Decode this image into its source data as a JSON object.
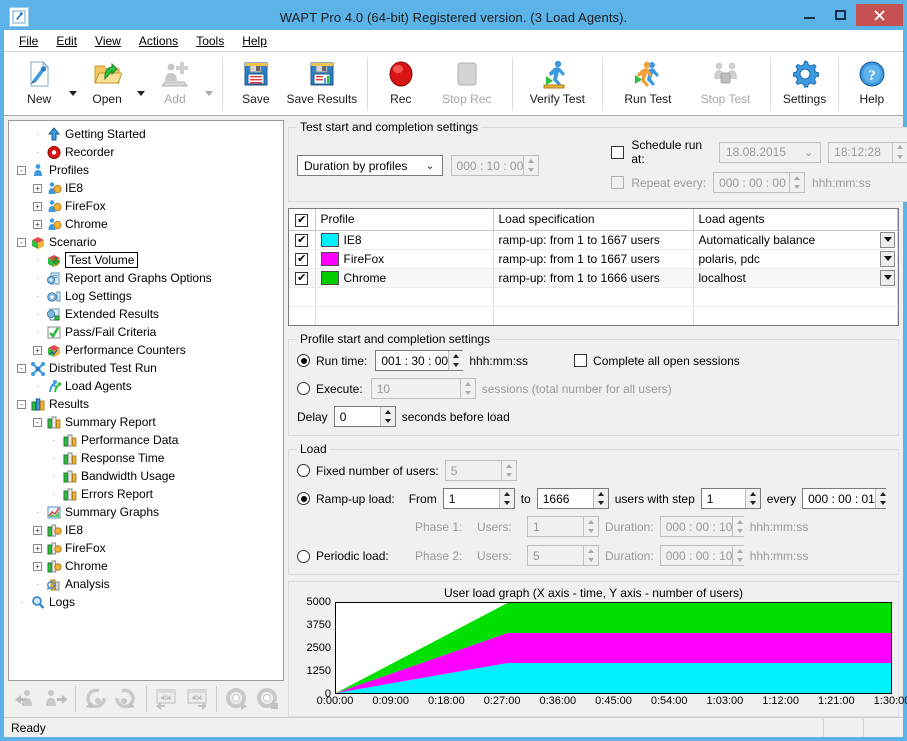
{
  "window": {
    "title": "WAPT Pro 4.0 (64-bit) Registered version. (3 Load Agents).",
    "minimize": "–",
    "maximize": "□",
    "close": "✕"
  },
  "menubar": {
    "items": [
      {
        "label": "File"
      },
      {
        "label": "Edit"
      },
      {
        "label": "View"
      },
      {
        "label": "Actions"
      },
      {
        "label": "Tools"
      },
      {
        "label": "Help"
      }
    ]
  },
  "toolbar": {
    "buttons": [
      {
        "label": "New",
        "icon": "new-document-icon",
        "enabled": true,
        "dropdown": true
      },
      {
        "label": "Open",
        "icon": "open-folder-icon",
        "enabled": true,
        "dropdown": true
      },
      {
        "label": "Add",
        "icon": "add-icon",
        "enabled": false,
        "dropdown": true
      },
      {
        "label": "Save",
        "icon": "save-disk-icon",
        "enabled": true,
        "dropdown": false
      },
      {
        "label": "Save Results",
        "icon": "save-results-icon",
        "enabled": true,
        "dropdown": false
      },
      {
        "label": "Rec",
        "icon": "record-icon",
        "enabled": true,
        "dropdown": false
      },
      {
        "label": "Stop Rec",
        "icon": "stop-record-icon",
        "enabled": false,
        "dropdown": false
      },
      {
        "label": "Verify Test",
        "icon": "verify-test-icon",
        "enabled": true,
        "dropdown": false
      },
      {
        "label": "Run Test",
        "icon": "run-test-icon",
        "enabled": true,
        "dropdown": false
      },
      {
        "label": "Stop Test",
        "icon": "stop-test-icon",
        "enabled": false,
        "dropdown": false
      },
      {
        "label": "Settings",
        "icon": "gear-icon",
        "enabled": true,
        "dropdown": false
      },
      {
        "label": "Help",
        "icon": "help-question-icon",
        "enabled": true,
        "dropdown": false
      }
    ]
  },
  "tree": {
    "nodes": [
      {
        "label": "Getting Started",
        "depth": 1,
        "expander": "",
        "icon": "up-arrow-icon",
        "selected": false
      },
      {
        "label": "Recorder",
        "depth": 1,
        "expander": "",
        "icon": "record-circle-icon",
        "selected": false
      },
      {
        "label": "Profiles",
        "depth": 0,
        "expander": "-",
        "icon": "person-icon",
        "selected": false
      },
      {
        "label": "IE8",
        "depth": 1,
        "expander": "+",
        "icon": "profile-icon",
        "selected": false
      },
      {
        "label": "FireFox",
        "depth": 1,
        "expander": "+",
        "icon": "profile-icon",
        "selected": false
      },
      {
        "label": "Chrome",
        "depth": 1,
        "expander": "+",
        "icon": "profile-icon",
        "selected": false
      },
      {
        "label": "Scenario",
        "depth": 0,
        "expander": "-",
        "icon": "scenario-box-icon",
        "selected": false
      },
      {
        "label": "Test Volume",
        "depth": 1,
        "expander": "",
        "icon": "test-volume-icon",
        "selected": true
      },
      {
        "label": "Report and Graphs Options",
        "depth": 1,
        "expander": "",
        "icon": "report-options-icon",
        "selected": false
      },
      {
        "label": "Log Settings",
        "depth": 1,
        "expander": "",
        "icon": "log-settings-icon",
        "selected": false
      },
      {
        "label": "Extended Results",
        "depth": 1,
        "expander": "",
        "icon": "extended-results-icon",
        "selected": false
      },
      {
        "label": "Pass/Fail Criteria",
        "depth": 1,
        "expander": "",
        "icon": "check-icon",
        "selected": false
      },
      {
        "label": "Performance Counters",
        "depth": 1,
        "expander": "+",
        "icon": "perf-counters-icon",
        "selected": false
      },
      {
        "label": "Distributed Test Run",
        "depth": 0,
        "expander": "-",
        "icon": "network-icon",
        "selected": false
      },
      {
        "label": "Load Agents",
        "depth": 1,
        "expander": "",
        "icon": "load-agents-icon",
        "selected": false
      },
      {
        "label": "Results",
        "depth": 0,
        "expander": "-",
        "icon": "results-icon",
        "selected": false
      },
      {
        "label": "Summary Report",
        "depth": 1,
        "expander": "-",
        "icon": "report-icon",
        "selected": false
      },
      {
        "label": "Performance Data",
        "depth": 2,
        "expander": "",
        "icon": "report-icon",
        "selected": false
      },
      {
        "label": "Response Time",
        "depth": 2,
        "expander": "",
        "icon": "report-icon",
        "selected": false
      },
      {
        "label": "Bandwidth Usage",
        "depth": 2,
        "expander": "",
        "icon": "report-icon",
        "selected": false
      },
      {
        "label": "Errors Report",
        "depth": 2,
        "expander": "",
        "icon": "report-icon",
        "selected": false
      },
      {
        "label": "Summary Graphs",
        "depth": 1,
        "expander": "",
        "icon": "graphs-icon",
        "selected": false
      },
      {
        "label": "IE8",
        "depth": 1,
        "expander": "+",
        "icon": "result-profile-icon",
        "selected": false
      },
      {
        "label": "FireFox",
        "depth": 1,
        "expander": "+",
        "icon": "result-profile-icon",
        "selected": false
      },
      {
        "label": "Chrome",
        "depth": 1,
        "expander": "+",
        "icon": "result-profile-icon",
        "selected": false
      },
      {
        "label": "Analysis",
        "depth": 1,
        "expander": "",
        "icon": "analysis-icon",
        "selected": false
      },
      {
        "label": "Logs",
        "depth": 0,
        "expander": "",
        "icon": "magnifier-icon",
        "selected": false
      }
    ]
  },
  "tree_toolbar": {
    "buttons": [
      {
        "name": "import-users-icon"
      },
      {
        "name": "export-users-icon"
      },
      {
        "name": "refresh-user-left-icon"
      },
      {
        "name": "refresh-user-right-icon"
      },
      {
        "name": "error-page-left-icon"
      },
      {
        "name": "error-page-right-icon"
      },
      {
        "name": "gear-play-icon"
      },
      {
        "name": "gear-stop-icon"
      }
    ]
  },
  "test_start": {
    "legend": "Test start and completion settings",
    "duration_mode": "Duration by profiles",
    "duration_value": "000 : 10 : 00",
    "duration_enabled": false,
    "schedule_label": "Schedule run at:",
    "schedule_checked": false,
    "schedule_date": "18.08.2015",
    "schedule_time": "18:12:28",
    "repeat_label": "Repeat every:",
    "repeat_checked": false,
    "repeat_value": "000 : 00 : 00",
    "repeat_format": "hhh:mm:ss"
  },
  "profiles_table": {
    "header_checkbox_checked": true,
    "columns": [
      "Profile",
      "Load specification",
      "Load agents"
    ],
    "rows": [
      {
        "checked": true,
        "color": "#00F0FF",
        "profile": "IE8",
        "load_spec": "ramp-up: from 1 to 1667 users",
        "agents": "Automatically balance"
      },
      {
        "checked": true,
        "color": "#FF00FF",
        "profile": "FireFox",
        "load_spec": "ramp-up: from 1 to 1667 users",
        "agents": "polaris, pdc"
      },
      {
        "checked": true,
        "color": "#00CC00",
        "profile": "Chrome",
        "load_spec": "ramp-up: from 1 to 1666 users",
        "agents": "localhost"
      }
    ],
    "empty_rows": 3
  },
  "profile_settings": {
    "legend": "Profile start and completion settings",
    "run_time_label": "Run time:",
    "run_time_selected": true,
    "run_time_value": "001 : 30 : 00",
    "run_time_format": "hhh:mm:ss",
    "complete_sessions_label": "Complete all open sessions",
    "complete_sessions_checked": false,
    "execute_label": "Execute:",
    "execute_selected": false,
    "execute_value": "10",
    "execute_suffix": "sessions (total number for all users)",
    "delay_label": "Delay",
    "delay_value": "0",
    "delay_suffix": "seconds before load"
  },
  "load": {
    "legend": "Load",
    "fixed_label": "Fixed number of users:",
    "fixed_selected": false,
    "fixed_value": "5",
    "rampup_label": "Ramp-up load:",
    "rampup_selected": true,
    "from_label": "From",
    "from_value": "1",
    "to_label": "to",
    "to_value": "1666",
    "step_label": "users with step",
    "step_value": "1",
    "every_label": "every",
    "every_value": "000 : 00 : 01",
    "periodic_label": "Periodic load:",
    "periodic_selected": false,
    "phase1_label": "Phase 1:",
    "phase1_users_label": "Users:",
    "phase1_users": "1",
    "phase1_duration_label": "Duration:",
    "phase1_duration": "000 : 00 : 10",
    "phase2_label": "Phase 2:",
    "phase2_users_label": "Users:",
    "phase2_users": "5",
    "phase2_duration_label": "Duration:",
    "phase2_duration": "000 : 00 : 10",
    "time_format": "hhh:mm:ss"
  },
  "chart_data": {
    "type": "area",
    "title": "User load graph (X axis - time, Y axis - number of users)",
    "xlabel": "time",
    "ylabel": "number of users",
    "stacked": true,
    "grid": false,
    "legend_position": "none",
    "ylim": [
      0,
      5000
    ],
    "yticks": [
      0,
      1250,
      2500,
      3750,
      5000
    ],
    "ytick_labels": [
      "0",
      "1250",
      "2500",
      "3750",
      "5000"
    ],
    "xticks": [
      "0:00:00",
      "0:09:00",
      "0:18:00",
      "0:27:00",
      "0:36:00",
      "0:45:00",
      "0:54:00",
      "1:03:00",
      "1:12:00",
      "1:21:00",
      "1:30:00"
    ],
    "x_minutes": [
      0,
      9,
      18,
      27,
      36,
      45,
      54,
      63,
      72,
      81,
      90
    ],
    "xlim_minutes": [
      0,
      90
    ],
    "ramp_end_minutes": 27.8,
    "series": [
      {
        "name": "IE8",
        "color": "#00F0FF",
        "plateau": 1667,
        "points": [
          [
            0,
            0
          ],
          [
            27.8,
            1667
          ],
          [
            90,
            1667
          ]
        ]
      },
      {
        "name": "FireFox",
        "color": "#FF00FF",
        "plateau": 1667,
        "points": [
          [
            0,
            0
          ],
          [
            27.8,
            1667
          ],
          [
            90,
            1667
          ]
        ]
      },
      {
        "name": "Chrome",
        "color": "#00E000",
        "plateau": 1666,
        "points": [
          [
            0,
            0
          ],
          [
            27.8,
            1666
          ],
          [
            90,
            1666
          ]
        ]
      }
    ],
    "cumulative_top": [
      0,
      5000
    ]
  },
  "statusbar": {
    "text": "Ready"
  }
}
